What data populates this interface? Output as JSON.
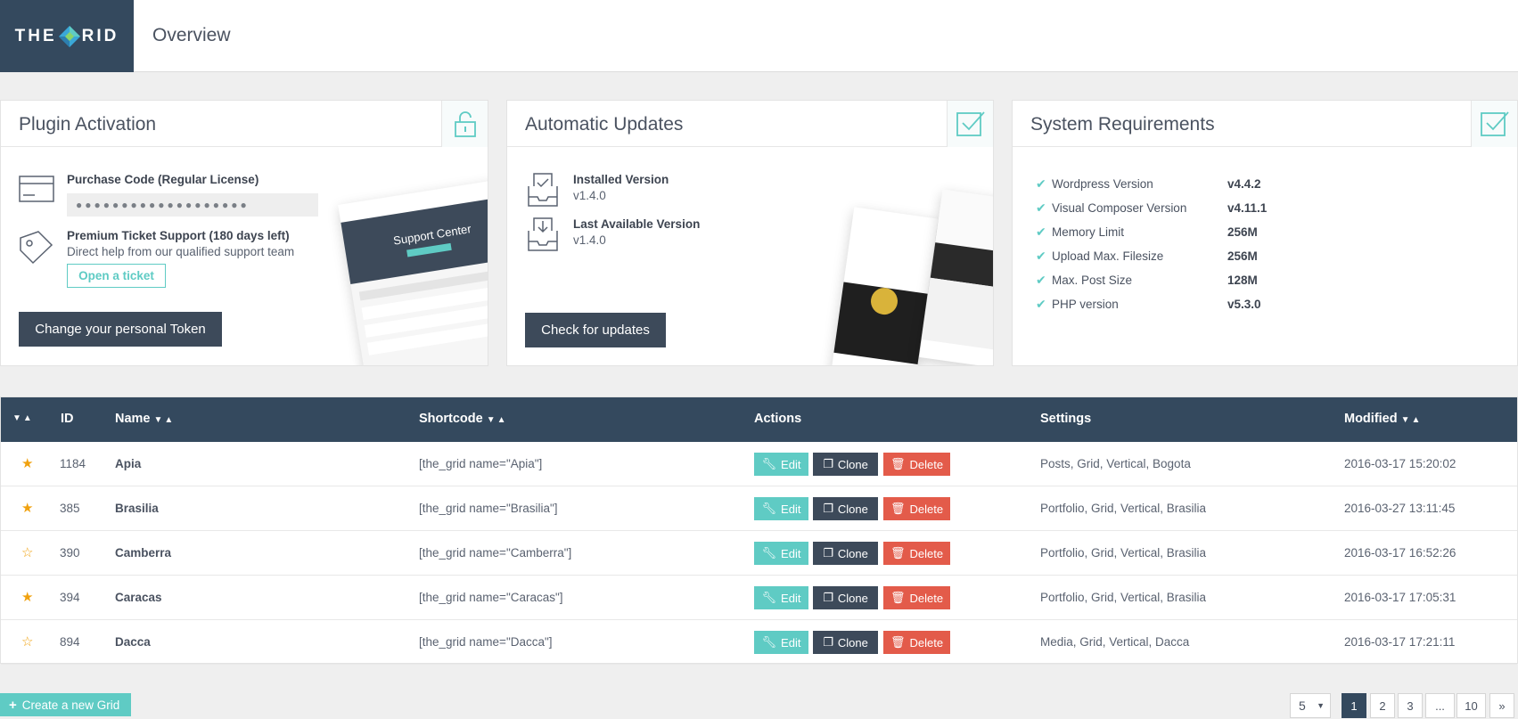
{
  "header": {
    "logo_left": "THE",
    "logo_right": "RID",
    "title": "Overview"
  },
  "activation": {
    "title": "Plugin Activation",
    "icon": "lock-icon",
    "purchase_label": "Purchase Code (Regular License)",
    "purchase_code": "●●●●●●●●●●●●●●●●●●●",
    "support_label": "Premium Ticket Support (180 days left)",
    "support_desc": "Direct help from our qualified support team",
    "ticket_button": "Open a ticket",
    "token_button": "Change your personal Token"
  },
  "updates": {
    "title": "Automatic Updates",
    "icon": "checkbox-icon",
    "installed_label": "Installed Version",
    "installed_value": "v1.4.0",
    "available_label": "Last Available Version",
    "available_value": "v1.4.0",
    "check_button": "Check for updates"
  },
  "requirements": {
    "title": "System Requirements",
    "icon": "checkbox-icon",
    "items": [
      {
        "name": "Wordpress Version",
        "value": "v4.4.2"
      },
      {
        "name": "Visual Composer Version",
        "value": "v4.11.1"
      },
      {
        "name": "Memory Limit",
        "value": "256M"
      },
      {
        "name": "Upload Max. Filesize",
        "value": "256M"
      },
      {
        "name": "Max. Post Size",
        "value": "128M"
      },
      {
        "name": "PHP version",
        "value": "v5.3.0"
      }
    ]
  },
  "table": {
    "headers": {
      "id": "ID",
      "name": "Name",
      "shortcode": "Shortcode",
      "actions": "Actions",
      "settings": "Settings",
      "modified": "Modified"
    },
    "sort_glyph": "▼▲",
    "action_labels": {
      "edit": "Edit",
      "clone": "Clone",
      "delete": "Delete"
    },
    "rows": [
      {
        "starred": true,
        "id": "1184",
        "name": "Apia",
        "shortcode": "[the_grid name=\"Apia\"]",
        "settings": "Posts, Grid, Vertical, Bogota",
        "modified": "2016-03-17 15:20:02"
      },
      {
        "starred": true,
        "id": "385",
        "name": "Brasilia",
        "shortcode": "[the_grid name=\"Brasilia\"]",
        "settings": "Portfolio, Grid, Vertical, Brasilia",
        "modified": "2016-03-27 13:11:45"
      },
      {
        "starred": false,
        "id": "390",
        "name": "Camberra",
        "shortcode": "[the_grid name=\"Camberra\"]",
        "settings": "Portfolio, Grid, Vertical, Brasilia",
        "modified": "2016-03-17 16:52:26"
      },
      {
        "starred": true,
        "id": "394",
        "name": "Caracas",
        "shortcode": "[the_grid name=\"Caracas\"]",
        "settings": "Portfolio, Grid, Vertical, Brasilia",
        "modified": "2016-03-17 17:05:31"
      },
      {
        "starred": false,
        "id": "894",
        "name": "Dacca",
        "shortcode": "[the_grid name=\"Dacca\"]",
        "settings": "Media, Grid, Vertical, Dacca",
        "modified": "2016-03-17 17:21:11"
      }
    ]
  },
  "footer": {
    "create_button": "Create a new Grid",
    "per_page": "5",
    "pages": [
      "1",
      "2",
      "3",
      "...",
      "10",
      "»"
    ],
    "active_page": "1"
  },
  "colors": {
    "navy": "#34495e",
    "teal": "#5fcbc4",
    "red": "#e35b4a",
    "star": "#f0a10e"
  }
}
